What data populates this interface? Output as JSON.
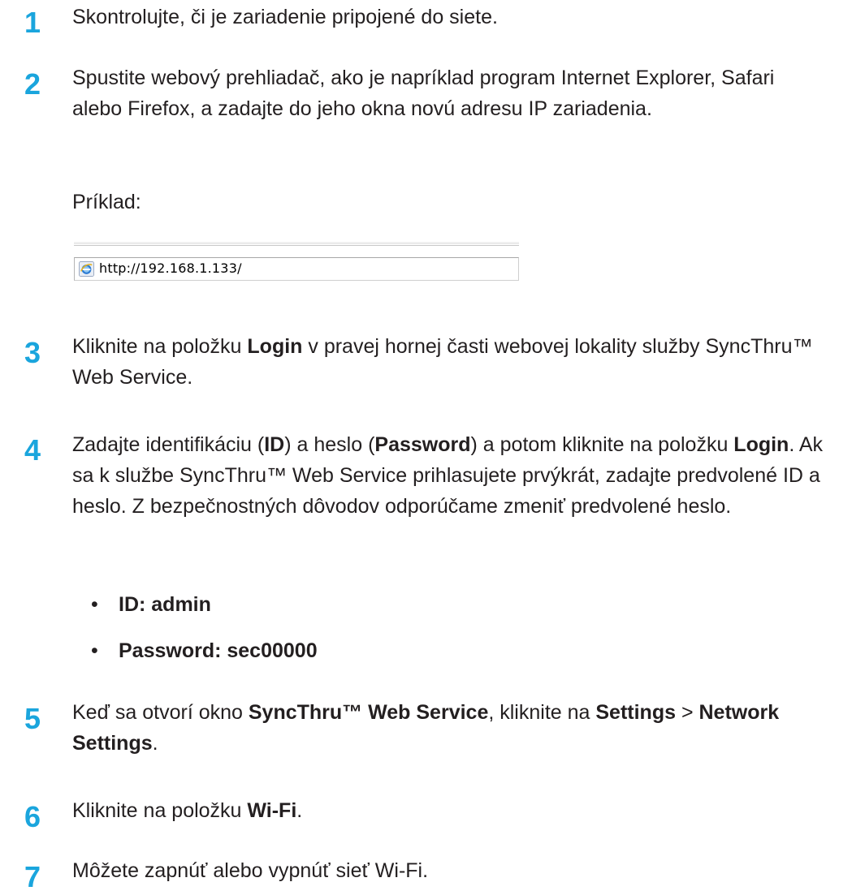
{
  "steps": [
    {
      "num": "1",
      "text": "Skontrolujte, či je zariadenie pripojené do siete."
    },
    {
      "num": "2",
      "text": "Spustite webový prehliadač, ako je napríklad program Internet Explorer, Safari alebo Firefox, a zadajte do jeho okna novú adresu IP zariadenia."
    },
    {
      "num": "3",
      "text_a": "Kliknite na položku ",
      "text_b": "Login",
      "text_c": " v pravej hornej časti webovej lokality služby SyncThru™ Web Service."
    },
    {
      "num": "4",
      "text_a": "Zadajte identifikáciu (",
      "text_b": "ID",
      "text_c": ") a heslo (",
      "text_d": "Password",
      "text_e": ") a potom kliknite na položku ",
      "text_f": "Login",
      "text_g": ". Ak sa k službe SyncThru™ Web Service prihlasujete prvýkrát, zadajte predvolené ID a heslo. Z bezpečnostných dôvodov odporúčame zmeniť predvolené heslo."
    },
    {
      "num": "5",
      "text_a": "Keď sa otvorí okno ",
      "text_b": "SyncThru™ Web Service",
      "text_c": ", kliknite na ",
      "text_d": "Settings",
      "text_e": " > ",
      "text_f": "Network Settings",
      "text_g": "."
    },
    {
      "num": "6",
      "text_a": "Kliknite na položku ",
      "text_b": "Wi-Fi",
      "text_c": "."
    },
    {
      "num": "7",
      "text": "Môžete zapnúť alebo vypnúť sieť Wi-Fi."
    }
  ],
  "example": {
    "label": "Príklad:",
    "url": "http://192.168.1.133/",
    "icon": "internet-explorer-icon"
  },
  "credentials": [
    {
      "bullet": "•",
      "text": "ID: admin"
    },
    {
      "bullet": "•",
      "text": "Password: sec00000"
    }
  ],
  "colors": {
    "step_number": "#1aa5dd",
    "body_text": "#231f20"
  }
}
